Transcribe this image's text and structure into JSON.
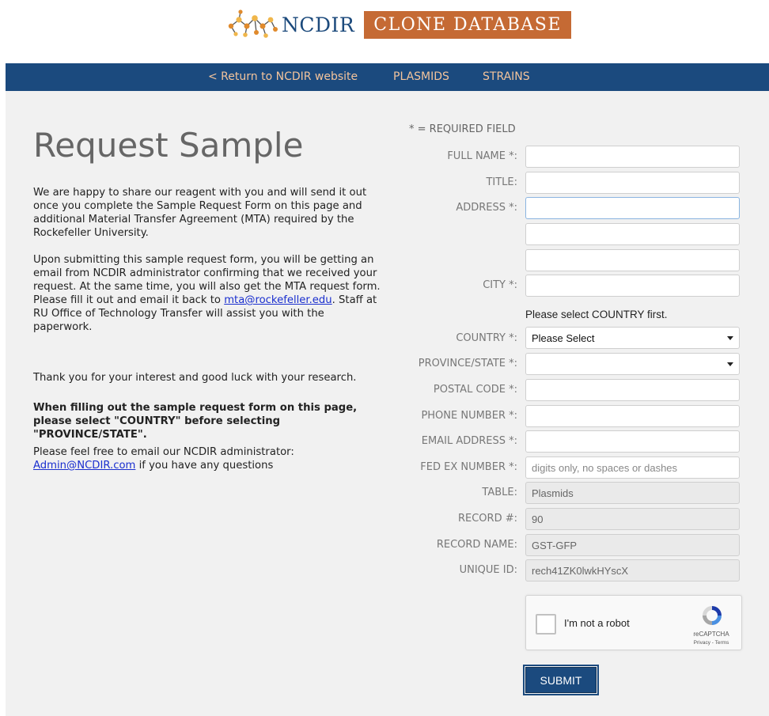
{
  "header": {
    "logo_text": "NCDIR",
    "logo_badge": "CLONE DATABASE",
    "colors": {
      "navy": "#1b4a7e",
      "orange": "#c56a34",
      "nav_link": "#f3c49c"
    }
  },
  "nav": {
    "items": [
      {
        "label": "< Return to NCDIR website"
      },
      {
        "label": "PLASMIDS"
      },
      {
        "label": "STRAINS"
      }
    ]
  },
  "intro": {
    "title": "Request Sample",
    "p1": "We are happy to share our reagent with you and will send it out once you complete the Sample Request Form on this page and additional Material Transfer Agreement (MTA) required by the Rockefeller University.",
    "p2_before": "Upon submitting this sample request form, you will be getting an email from NCDIR administrator confirming that we received your request. At the same time, you will also get the MTA request form. Please fill it out and email it back to ",
    "p2_link": "mta@rockefeller.edu",
    "p2_after": ". Staff at RU Office of Technology Transfer will assist you with the paperwork.",
    "p3": "Thank you for your interest and good luck with your research.",
    "p4": "When filling out the sample request form on this page, please select \"COUNTRY\" before selecting \"PROVINCE/STATE\".",
    "p5_before": "Please feel free to email our NCDIR administrator: ",
    "p5_link": "Admin@NCDIR.com",
    "p5_after": " if you have any questions"
  },
  "form": {
    "required_note": "* = REQUIRED FIELD",
    "labels": {
      "full_name": "FULL NAME *:",
      "title": "TITLE:",
      "address": "ADDRESS *:",
      "city": "CITY *:",
      "country": "COUNTRY *:",
      "province": "PROVINCE/STATE *:",
      "postal": "POSTAL CODE *:",
      "phone": "PHONE NUMBER *:",
      "email": "EMAIL ADDRESS *:",
      "fedex": "FED EX NUMBER *:",
      "table": "TABLE:",
      "record_no": "RECORD #:",
      "record_name": "RECORD NAME:",
      "unique_id": "UNIQUE ID:"
    },
    "country_hint": "Please select COUNTRY first.",
    "country_value": "Please Select",
    "province_value": "",
    "fedex_placeholder": "digits only, no spaces or dashes",
    "table_value": "Plasmids",
    "record_no_value": "90",
    "record_name_value": "GST-GFP",
    "unique_id_value": "rech41ZK0lwkHYscX",
    "recaptcha": {
      "label": "I'm not a robot",
      "brand": "reCAPTCHA",
      "terms": "Privacy - Terms"
    },
    "submit_label": "SUBMIT"
  }
}
